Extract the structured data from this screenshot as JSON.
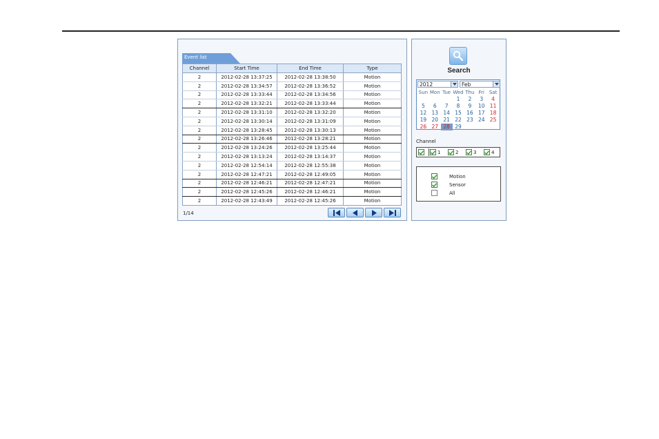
{
  "event_list": {
    "tab_label": "Event list",
    "columns": [
      "Channel",
      "Start Time",
      "End Time",
      "Type"
    ],
    "rows": [
      {
        "channel": "2",
        "start": "2012-02-28 13:37:25",
        "end": "2012-02-28 13:38:50",
        "type": "Motion"
      },
      {
        "channel": "2",
        "start": "2012-02-28 13:34:57",
        "end": "2012-02-28 13:36:52",
        "type": "Motion"
      },
      {
        "channel": "2",
        "start": "2012-02-28 13:33:44",
        "end": "2012-02-28 13:34:56",
        "type": "Motion"
      },
      {
        "channel": "2",
        "start": "2012-02-28 13:32:21",
        "end": "2012-02-28 13:33:44",
        "type": "Motion"
      },
      {
        "channel": "2",
        "start": "2012-02-28 13:31:10",
        "end": "2012-02-28 13:32:20",
        "type": "Motion"
      },
      {
        "channel": "2",
        "start": "2012-02-28 13:30:14",
        "end": "2012-02-28 13:31:09",
        "type": "Motion"
      },
      {
        "channel": "2",
        "start": "2012-02-28 13:28:45",
        "end": "2012-02-28 13:30:13",
        "type": "Motion"
      },
      {
        "channel": "2",
        "start": "2012-02-28 13:26:46",
        "end": "2012-02-28 13:28:21",
        "type": "Motion"
      },
      {
        "channel": "2",
        "start": "2012-02-28 13:24:26",
        "end": "2012-02-28 13:25:44",
        "type": "Motion"
      },
      {
        "channel": "2",
        "start": "2012-02-28 13:13:24",
        "end": "2012-02-28 13:14:37",
        "type": "Motion"
      },
      {
        "channel": "2",
        "start": "2012-02-28 12:54:14",
        "end": "2012-02-28 12:55:38",
        "type": "Motion"
      },
      {
        "channel": "2",
        "start": "2012-02-28 12:47:21",
        "end": "2012-02-28 12:49:05",
        "type": "Motion"
      },
      {
        "channel": "2",
        "start": "2012-02-28 12:46:21",
        "end": "2012-02-28 12:47:21",
        "type": "Motion"
      },
      {
        "channel": "2",
        "start": "2012-02-28 12:45:26",
        "end": "2012-02-28 12:46:21",
        "type": "Motion"
      },
      {
        "channel": "2",
        "start": "2012-02-28 12:43:49",
        "end": "2012-02-28 12:45:26",
        "type": "Motion"
      }
    ],
    "page_indicator": "1/14",
    "pager_icons": [
      "first-page-icon",
      "prev-page-icon",
      "next-page-icon",
      "last-page-icon"
    ]
  },
  "search": {
    "button_label": "Search",
    "icon": "magnifier-icon"
  },
  "calendar": {
    "year": "2012",
    "month": "Feb",
    "weekdays": [
      "Sun",
      "Mon",
      "Tue",
      "Wed",
      "Thu",
      "Fri",
      "Sat"
    ],
    "first_weekday_index": 3,
    "days": [
      "1",
      "2",
      "3",
      "4",
      "5",
      "6",
      "7",
      "8",
      "9",
      "10",
      "11",
      "12",
      "13",
      "14",
      "15",
      "16",
      "17",
      "18",
      "19",
      "20",
      "21",
      "22",
      "23",
      "24",
      "25",
      "26",
      "27",
      "28",
      "29"
    ],
    "weekend_days": [
      "4",
      "11",
      "18",
      "25",
      "26",
      "27",
      "28"
    ],
    "selected_day": "28"
  },
  "channels": {
    "label": "Channel",
    "all_checked": true,
    "items": [
      {
        "label": "1",
        "checked": true
      },
      {
        "label": "2",
        "checked": true
      },
      {
        "label": "3",
        "checked": true
      },
      {
        "label": "4",
        "checked": true
      }
    ]
  },
  "event_types": [
    {
      "label": "Motion",
      "checked": true
    },
    {
      "label": "Sensor",
      "checked": true
    },
    {
      "label": "All",
      "checked": false
    }
  ],
  "colors": {
    "panel_bg": "#f3f6fb",
    "panel_border": "#7f9dbd",
    "tab_blue": "#6f9fd8",
    "weekday_blue": "#1f5c9a",
    "weekend_red": "#d0202a",
    "selected_day_bg": "#7a9cc8",
    "check_green": "#2e8b2e"
  }
}
